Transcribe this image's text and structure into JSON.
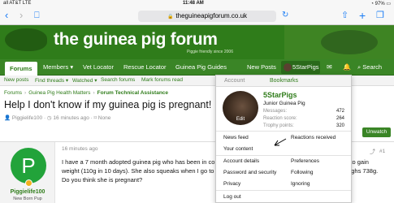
{
  "status_bar": {
    "carrier": "all AT&T  LTE",
    "time": "11:48 AM",
    "battery": "◔ 97% ▭"
  },
  "browser": {
    "back_icon": "back-chevron-icon",
    "url": "theguineapigforum.co.uk"
  },
  "site": {
    "title": "the guinea pig forum",
    "tagline": "Piggie friendly since 2006"
  },
  "nav": {
    "items": [
      "Forums",
      "Members ▾",
      "Vet Locator",
      "Rescue Locator",
      "Guinea Pig Guides",
      "New Posts"
    ],
    "user_chip": "5StarPigs",
    "search": "Search"
  },
  "subnav": [
    "New posts",
    "Find threads ▾",
    "Watched ▾",
    "Search forums",
    "Mark forums read"
  ],
  "breadcrumb": [
    "Forums",
    "Guinea Pig Health Matters",
    "Forum Technical Assistance"
  ],
  "thread": {
    "title": "Help I don't know if my guinea pig is pregnant!",
    "author": "Piggielife100",
    "time": "16 minutes ago",
    "tags": "None",
    "unwatch_label": "Unwatch"
  },
  "post": {
    "avatar_letter": "P",
    "username": "Piggielife100",
    "user_title": "New Born Pup",
    "time": "16 minutes ago",
    "number": "#1",
    "body_line1": "I have a 7 month adopted guinea pig who has been in conta",
    "body_line1_right": "ed to gain",
    "body_line2": "weight (110g in 10 days). She also squeaks when I go to pic",
    "body_line2_right": "weighs 738g.",
    "body_line3": "Do you think she is pregnant?"
  },
  "popup": {
    "tab_account": "Account",
    "tab_bookmarks": "Bookmarks",
    "avatar_edit": "Edit",
    "username": "5StarPigs",
    "user_title": "Junior Guinea Pig",
    "stats": [
      {
        "label": "Messages:",
        "value": "472"
      },
      {
        "label": "Reaction score:",
        "value": "264"
      },
      {
        "label": "Trophy points:",
        "value": "320"
      }
    ],
    "links": {
      "news_feed": "News feed",
      "reactions_received": "Reactions received",
      "your_content": "Your content",
      "account_details": "Account details",
      "preferences": "Preferences",
      "password_security": "Password and security",
      "following": "Following",
      "privacy": "Privacy",
      "ignoring": "Ignoring",
      "log_out": "Log out"
    }
  },
  "colors": {
    "brand_green": "#2f7c1a",
    "nav_green": "#3a8526",
    "avatar_green": "#22a33a"
  }
}
